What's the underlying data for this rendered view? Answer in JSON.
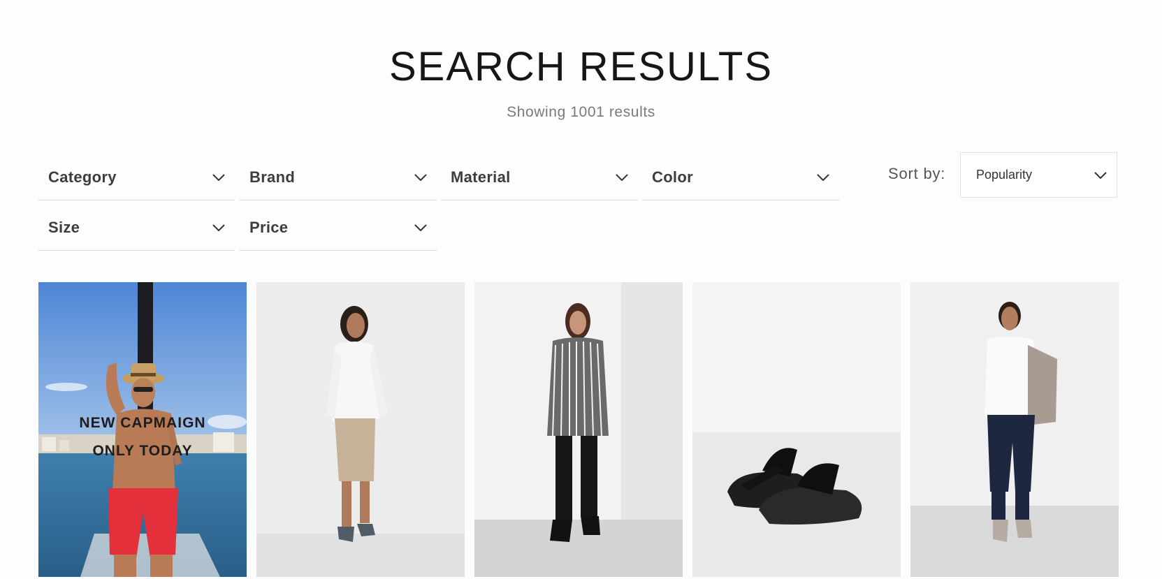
{
  "page": {
    "title": "SEARCH RESULTS",
    "result_count_text": "Showing 1001 results"
  },
  "filters": [
    {
      "label": "Category",
      "icon": "chevron-down-icon"
    },
    {
      "label": "Brand",
      "icon": "chevron-down-icon"
    },
    {
      "label": "Material",
      "icon": "chevron-down-icon"
    },
    {
      "label": "Color",
      "icon": "chevron-down-icon"
    },
    {
      "label": "Size",
      "icon": "chevron-down-icon"
    },
    {
      "label": "Price",
      "icon": "chevron-down-icon"
    }
  ],
  "sort": {
    "label": "Sort by:",
    "selected": "Popularity",
    "icon": "chevron-down-icon"
  },
  "promo": {
    "line1": "NEW CAPMAIGN",
    "line2": "ONLY TODAY"
  },
  "products": [
    {
      "image": "man-on-boat-red-shorts-straw-hat"
    },
    {
      "image": "woman-white-shirt-beige-skirt"
    },
    {
      "image": "woman-striped-shirt-black-pants"
    },
    {
      "image": "black-leather-sandals"
    },
    {
      "image": "woman-white-top-jeans-backpack"
    }
  ],
  "colors": {
    "background": "#fdfdfd",
    "title": "#161616",
    "subtitle": "#7a7a7a",
    "filter_text": "#3d3d3d",
    "divider": "#d8d8d8"
  }
}
